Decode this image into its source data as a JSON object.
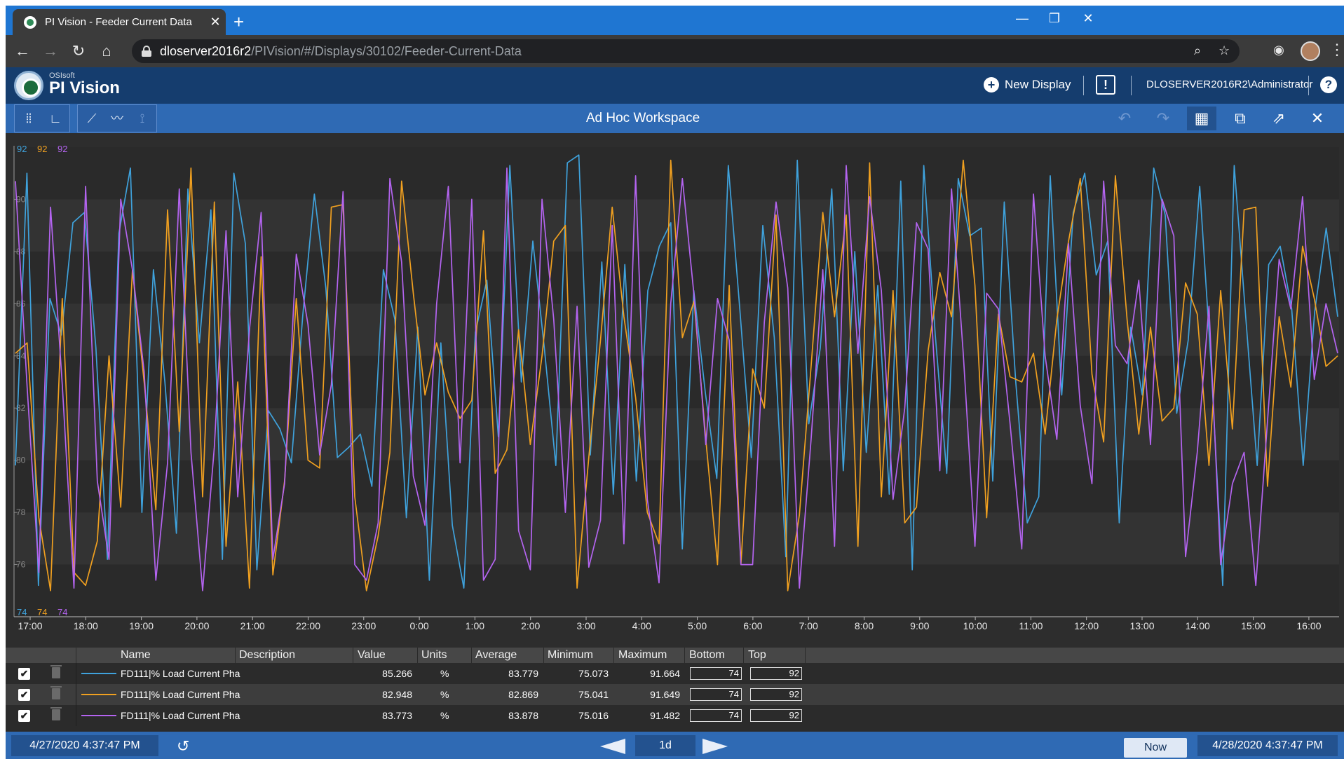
{
  "browser": {
    "tab_title": "PI Vision - Feeder Current Data",
    "tab_close": "✕",
    "new_tab": "+",
    "url_host": "dloserver2016r2",
    "url_path": "/PIVision/#/Displays/30102/Feeder-Current-Data",
    "window_min": "—",
    "window_restore": "❐",
    "window_close": "✕"
  },
  "header": {
    "brand_small": "OSIsoft",
    "brand": "PI Vision",
    "new_display": "New Display",
    "user": "DLOSERVER2016R2\\Administrator",
    "help": "?",
    "alert": "!"
  },
  "workspace": {
    "title": "Ad Hoc Workspace"
  },
  "chart_data": {
    "type": "line",
    "ylim": [
      74,
      92
    ],
    "scale_labels": {
      "top": [
        "92",
        "92",
        "92"
      ],
      "bottom": [
        "74",
        "74",
        "74"
      ]
    },
    "y_ticks": [
      "76",
      "78",
      "80",
      "82",
      "84",
      "86",
      "88",
      "90"
    ],
    "x_ticks": [
      "17:00",
      "18:00",
      "19:00",
      "20:00",
      "21:00",
      "22:00",
      "23:00",
      "0:00",
      "1:00",
      "2:00",
      "3:00",
      "4:00",
      "5:00",
      "6:00",
      "7:00",
      "8:00",
      "9:00",
      "10:00",
      "11:00",
      "12:00",
      "13:00",
      "14:00",
      "15:00",
      "16:00"
    ],
    "series": [
      {
        "color": "#3fa2dc",
        "values": [
          79.8,
          91.0,
          75.2,
          86.2,
          84.8,
          89.1,
          89.5,
          84.3,
          76.2,
          88.7,
          91.2,
          78.0,
          87.3,
          83.0,
          77.2,
          90.4,
          84.5,
          89.6,
          76.2,
          91.0,
          88.3,
          75.8,
          81.9,
          81.2,
          79.9,
          85.6,
          90.2,
          86.6,
          80.1,
          80.5,
          81.0,
          79.0,
          87.3,
          85.4,
          77.8,
          85.1,
          75.4,
          84.5,
          77.5,
          75.1,
          84.9,
          86.9,
          80.9,
          91.3,
          83.0,
          88.4,
          84.3,
          79.8,
          91.4,
          91.7,
          80.2,
          87.6,
          78.7,
          87.5,
          79.2,
          86.5,
          88.2,
          89.1,
          76.6,
          86.5,
          82.6,
          79.3,
          91.3,
          85.8,
          80.1,
          89.0,
          84.7,
          76.3,
          91.5,
          81.4,
          84.3,
          90.4,
          79.6,
          88.0,
          80.3,
          86.7,
          78.7,
          90.7,
          75.8,
          91.3,
          84.8,
          79.5,
          90.8,
          88.6,
          88.9,
          79.2,
          89.9,
          83.0,
          77.6,
          78.6,
          90.9,
          82.5,
          89.5,
          91.0,
          87.1,
          88.4,
          77.6,
          85.1,
          82.5,
          91.2,
          89.4,
          81.8,
          84.6,
          90.5,
          83.6,
          75.2,
          91.3,
          85.5,
          79.8,
          87.5,
          88.2,
          85.8,
          79.8,
          85.7,
          88.9,
          85.5
        ]
      },
      {
        "color": "#f0a020",
        "values": [
          84.1,
          84.5,
          77.8,
          75.0,
          86.2,
          75.7,
          75.2,
          76.9,
          84.0,
          78.2,
          87.3,
          83.0,
          78.1,
          89.6,
          81.1,
          91.2,
          78.6,
          89.9,
          76.7,
          83.0,
          75.1,
          87.8,
          75.6,
          79.2,
          86.2,
          80.0,
          79.7,
          89.7,
          89.8,
          78.6,
          75.0,
          77.1,
          80.3,
          90.7,
          86.4,
          82.5,
          84.5,
          82.6,
          81.6,
          82.3,
          88.8,
          79.5,
          80.4,
          85.0,
          80.6,
          84.0,
          88.4,
          89.0,
          75.1,
          80.1,
          84.6,
          89.7,
          85.5,
          82.4,
          78.0,
          76.8,
          91.5,
          84.7,
          86.1,
          80.8,
          76.0,
          86.7,
          76.0,
          83.5,
          82.0,
          89.4,
          75.0,
          77.9,
          83.6,
          89.5,
          85.5,
          89.4,
          76.7,
          91.4,
          78.6,
          86.5,
          77.6,
          78.2,
          84.2,
          87.2,
          85.5,
          91.5,
          86.7,
          77.8,
          85.6,
          83.2,
          83.0,
          84.1,
          81.0,
          85.4,
          88.4,
          90.8,
          83.3,
          80.7,
          90.9,
          85.4,
          81.0,
          85.1,
          81.5,
          82.0,
          86.8,
          85.6,
          79.8,
          86.5,
          81.2,
          89.6,
          89.7,
          79.0,
          85.5,
          82.8,
          88.2,
          86.2,
          83.6,
          84.0
        ]
      },
      {
        "color": "#b464f0",
        "values": [
          90.7,
          82.8,
          75.7,
          89.7,
          82.9,
          75.1,
          90.5,
          79.2,
          76.2,
          90.0,
          87.3,
          83.4,
          75.4,
          79.9,
          90.4,
          80.3,
          75.0,
          80.5,
          88.8,
          78.6,
          85.0,
          89.5,
          76.2,
          79.1,
          87.9,
          85.2,
          80.2,
          82.9,
          90.3,
          76.0,
          75.4,
          77.6,
          90.8,
          87.6,
          79.4,
          77.5,
          86.0,
          90.5,
          79.9,
          90.0,
          75.4,
          76.2,
          91.2,
          77.3,
          75.8,
          90.0,
          85.4,
          78.0,
          85.9,
          75.9,
          77.7,
          89.0,
          76.8,
          90.9,
          78.5,
          75.3,
          86.0,
          90.8,
          86.3,
          80.6,
          86.2,
          84.6,
          76.0,
          76.0,
          85.3,
          89.9,
          86.6,
          75.1,
          80.8,
          87.3,
          76.7,
          91.3,
          84.1,
          90.1,
          86.5,
          78.5,
          82.0,
          89.1,
          88.1,
          79.6,
          90.4,
          84.1,
          76.7,
          86.4,
          85.8,
          81.4,
          76.6,
          90.2,
          84.0,
          80.8,
          88.3,
          82.1,
          79.1,
          90.7,
          84.4,
          83.7,
          86.9,
          80.6,
          90.0,
          88.6,
          76.3,
          80.3,
          85.9,
          76.0,
          79.1,
          80.3,
          75.2,
          81.5,
          87.7,
          85.8,
          90.1,
          83.1,
          86.0,
          84.1
        ]
      }
    ]
  },
  "table": {
    "headers": {
      "name": "Name",
      "description": "Description",
      "value": "Value",
      "units": "Units",
      "average": "Average",
      "minimum": "Minimum",
      "maximum": "Maximum",
      "bottom": "Bottom",
      "top": "Top"
    },
    "rows": [
      {
        "color": "#3fa2dc",
        "name": "FD111|% Load Current Pha",
        "value": "85.266",
        "units": "%",
        "average": "83.779",
        "minimum": "75.073",
        "maximum": "91.664",
        "bottom": "74",
        "top": "92"
      },
      {
        "color": "#f0a020",
        "name": "FD111|% Load Current Pha",
        "value": "82.948",
        "units": "%",
        "average": "82.869",
        "minimum": "75.041",
        "maximum": "91.649",
        "bottom": "74",
        "top": "92"
      },
      {
        "color": "#b464f0",
        "name": "FD111|% Load Current Pha",
        "value": "83.773",
        "units": "%",
        "average": "83.878",
        "minimum": "75.016",
        "maximum": "91.482",
        "bottom": "74",
        "top": "92"
      }
    ],
    "check": "✔"
  },
  "footer": {
    "start_time": "4/27/2020 4:37:47 PM",
    "duration": "1d",
    "now": "Now",
    "end_time": "4/28/2020 4:37:47 PM",
    "refresh": "↺"
  }
}
